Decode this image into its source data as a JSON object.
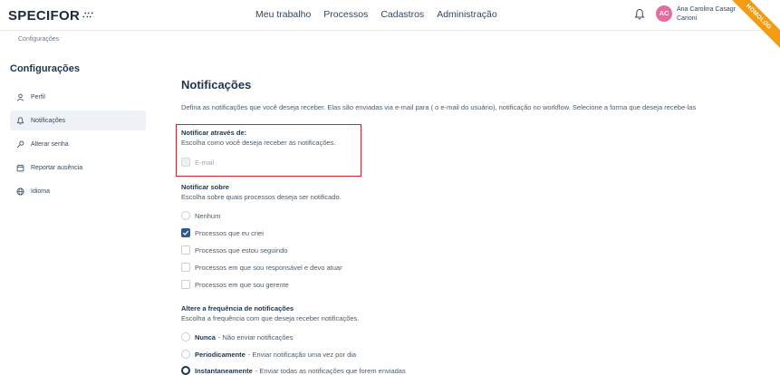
{
  "app": {
    "logo": "SPECIFOR",
    "logo_dots": "∴∵",
    "ribbon": "HOMOLOG"
  },
  "nav": {
    "items": [
      "Meu trabalho",
      "Processos",
      "Cadastros",
      "Administração"
    ]
  },
  "user": {
    "initials": "AC",
    "name_line1": "Ana Carolina Casagr",
    "name_line2": "Carioni"
  },
  "breadcrumb": "Configurações",
  "sidebar": {
    "title": "Configurações",
    "items": [
      {
        "label": "Perfil",
        "icon": "user-icon",
        "active": false
      },
      {
        "label": "Notificações",
        "icon": "bell-icon",
        "active": true
      },
      {
        "label": "Alterar senha",
        "icon": "key-icon",
        "active": false
      },
      {
        "label": "Reportar ausência",
        "icon": "calendar-icon",
        "active": false
      },
      {
        "label": "Idioma",
        "icon": "globe-icon",
        "active": false
      }
    ]
  },
  "main": {
    "title": "Notificações",
    "description": "Defina as notificações que você deseja receber. Elas são enviadas via e-mail para ( o e-mail do usuário), notificação no workflow. Selecione a forma que deseja recebe-las",
    "via": {
      "title": "Notificar através de:",
      "subtitle": "Escolha como você deseja receber as notificações.",
      "options": [
        {
          "label": "E-mail",
          "checked": false,
          "disabled": true
        }
      ]
    },
    "about": {
      "title": "Notificar sobre",
      "subtitle": "Escolha sobre quais processos deseja ser notificado.",
      "none_label": "Nenhum",
      "options": [
        {
          "label": "Processos que eu criei",
          "checked": true
        },
        {
          "label": "Processos que estou seguindo",
          "checked": false
        },
        {
          "label": "Processos em que sou responsável e devo atuar",
          "checked": false
        },
        {
          "label": "Processos em que sou gerente",
          "checked": false
        }
      ]
    },
    "frequency": {
      "title": "Altere a frequência de notificações",
      "subtitle": "Escolha a frequência com que deseja receber notificações.",
      "options": [
        {
          "name": "Nunca",
          "detail": " - Não enviar notificações",
          "selected": false
        },
        {
          "name": "Periodicamente",
          "detail": " - Enviar notificação uma vez por dia",
          "selected": false
        },
        {
          "name": "Instantaneamente",
          "detail": " - Enviar todas as notificações que forem enviadas",
          "selected": true
        }
      ]
    }
  },
  "colors": {
    "accent": "#2c5a8c",
    "highlight_box": "#d9232d",
    "ribbon": "#f39c12",
    "avatar": "#e86aa0"
  }
}
